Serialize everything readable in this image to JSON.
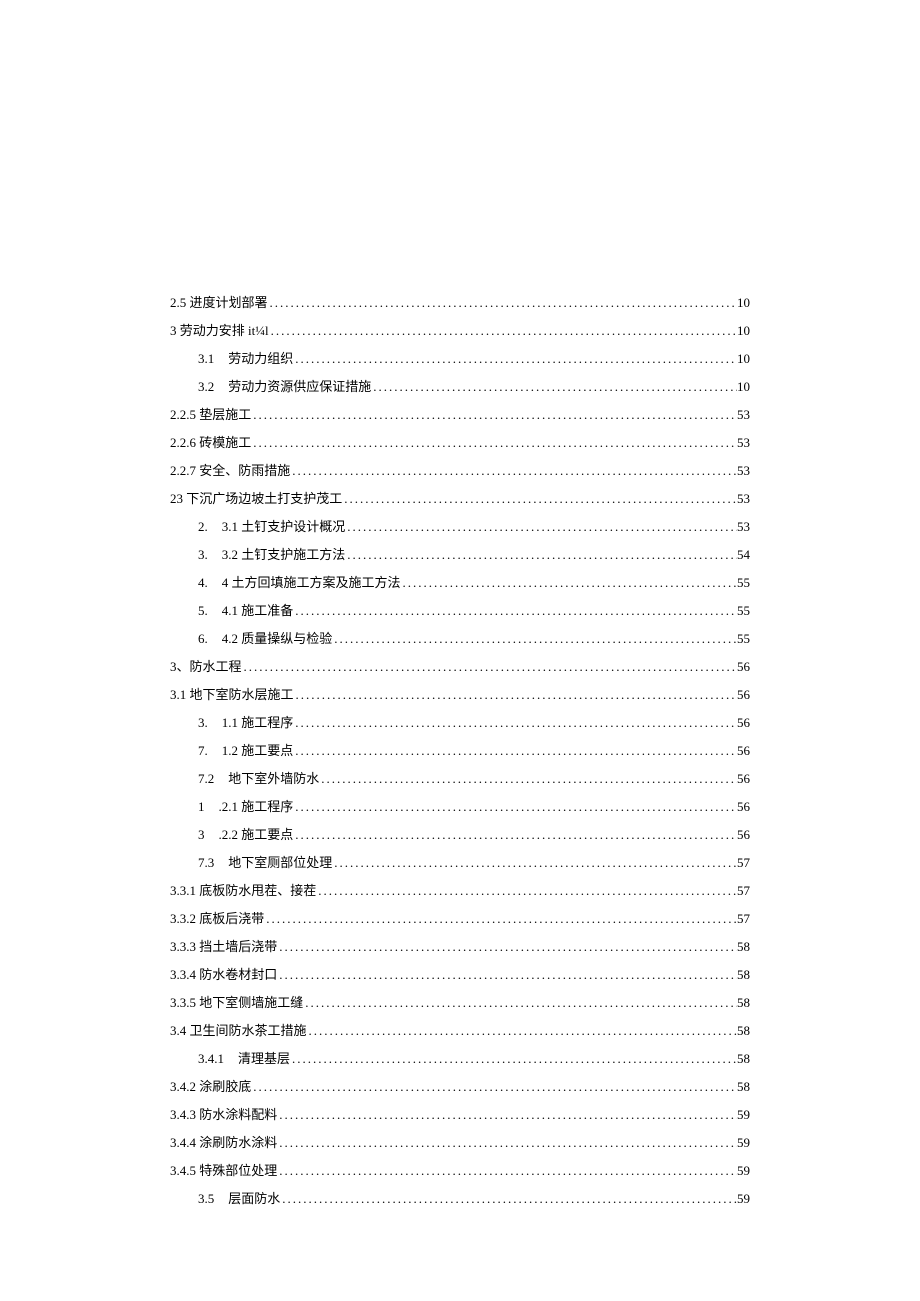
{
  "toc": [
    {
      "prefix": "",
      "title": "2.5 进度计划部署",
      "page": "10",
      "indent": 0
    },
    {
      "prefix": "",
      "title": "3 劳动力安排 it¼l",
      "page": "10",
      "indent": 0
    },
    {
      "prefix": "3.1",
      "title": "劳动力组织",
      "page": "10",
      "indent": 1
    },
    {
      "prefix": "3.2",
      "title": "劳动力资源供应保证措施",
      "page": "10",
      "indent": 1
    },
    {
      "prefix": "",
      "title": "2.2.5 垫层施工",
      "page": "53",
      "indent": 0
    },
    {
      "prefix": "",
      "title": "2.2.6 砖模施工",
      "page": "53",
      "indent": 0
    },
    {
      "prefix": "",
      "title": "2.2.7 安全、防雨措施",
      "page": "53",
      "indent": 0
    },
    {
      "prefix": "",
      "title": "23 下沉广场边坡土打支护茂工",
      "page": "53",
      "indent": 0
    },
    {
      "prefix": "2.",
      "title": "3.1 土钉支护设计概况",
      "page": "53",
      "indent": 1
    },
    {
      "prefix": "3.",
      "title": "3.2 土钉支护施工方法",
      "page": "54",
      "indent": 1
    },
    {
      "prefix": "4.",
      "title": "4 土方回填施工方案及施工方法",
      "page": "55",
      "indent": 1
    },
    {
      "prefix": "5.",
      "title": "4.1 施工准备",
      "page": "55",
      "indent": 1
    },
    {
      "prefix": "6.",
      "title": "4.2 质量操纵与检验",
      "page": "55",
      "indent": 1
    },
    {
      "prefix": "",
      "title": "3、防水工程",
      "page": "56",
      "indent": 0
    },
    {
      "prefix": "",
      "title": "3.1 地下室防水层施工",
      "page": "56",
      "indent": 0
    },
    {
      "prefix": "3.",
      "title": "1.1 施工程序",
      "page": "56",
      "indent": 1
    },
    {
      "prefix": "7.",
      "title": "1.2 施工要点",
      "page": "56",
      "indent": 1
    },
    {
      "prefix": "7.2",
      "title": "地下室外墙防水",
      "page": "56",
      "indent": 1
    },
    {
      "prefix": "1",
      "title": ".2.1 施工程序",
      "page": "56",
      "indent": 1
    },
    {
      "prefix": "3",
      "title": ".2.2 施工要点",
      "page": "56",
      "indent": 1
    },
    {
      "prefix": "7.3",
      "title": "地下室厕部位处理",
      "page": "57",
      "indent": 1
    },
    {
      "prefix": "",
      "title": "3.3.1 底板防水甩茬、接茬",
      "page": "57",
      "indent": 0
    },
    {
      "prefix": "",
      "title": "3.3.2 底板后浇带",
      "page": "57",
      "indent": 0
    },
    {
      "prefix": "",
      "title": "3.3.3 挡土墙后浇带",
      "page": "58",
      "indent": 0
    },
    {
      "prefix": "",
      "title": "3.3.4 防水卷材封口",
      "page": "58",
      "indent": 0
    },
    {
      "prefix": "",
      "title": "3.3.5 地下室侧墙施工缝",
      "page": "58",
      "indent": 0
    },
    {
      "prefix": "",
      "title": "3.4 卫生间防水茶工措施",
      "page": "58",
      "indent": 0
    },
    {
      "prefix": "3.4.1",
      "title": "清理基层",
      "page": "58",
      "indent": 1
    },
    {
      "prefix": "",
      "title": "3.4.2 涂刷胶底",
      "page": "58",
      "indent": 0
    },
    {
      "prefix": "",
      "title": "3.4.3 防水涂料配料",
      "page": "59",
      "indent": 0
    },
    {
      "prefix": "",
      "title": "3.4.4 涂刷防水涂料",
      "page": "59",
      "indent": 0
    },
    {
      "prefix": "",
      "title": "3.4.5 特殊部位处理",
      "page": "59",
      "indent": 0
    },
    {
      "prefix": "3.5",
      "title": "层面防水",
      "page": "59",
      "indent": 1
    }
  ]
}
